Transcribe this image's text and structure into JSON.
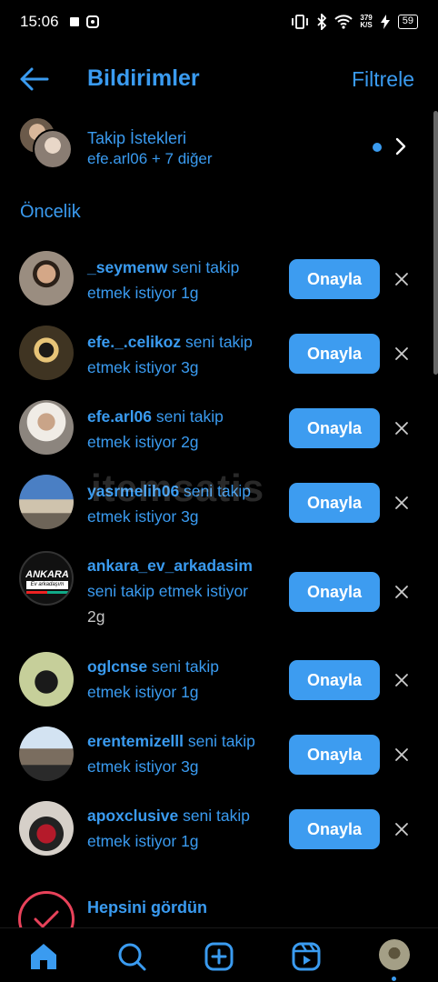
{
  "status_bar": {
    "time": "15:06",
    "net_speed_top": "379",
    "net_speed_bottom": "K/S",
    "battery": "59"
  },
  "header": {
    "title": "Bildirimler",
    "filter_label": "Filtrele"
  },
  "follow_requests": {
    "title": "Takip İstekleri",
    "subtitle": "efe.arl06 + 7 diğer"
  },
  "section_title": "Öncelik",
  "approve_label": "Onayla",
  "requests": [
    {
      "username": "_seymenw",
      "line1_rest": " seni takip",
      "line2": "etmek istiyor 1g",
      "line3": ""
    },
    {
      "username": "efe._.celikoz",
      "line1_rest": " seni takip",
      "line2": "etmek istiyor 3g",
      "line3": ""
    },
    {
      "username": "efe.arl06",
      "line1_rest": " seni takip",
      "line2": "etmek istiyor 2g",
      "line3": ""
    },
    {
      "username": "yasrmelih06",
      "line1_rest": " seni takip",
      "line2": "etmek istiyor 3g",
      "line3": ""
    },
    {
      "username": "ankara_ev_arkadasim",
      "line1_rest": "",
      "line2": "seni takip etmek istiyor",
      "line3": "2g"
    },
    {
      "username": "oglcnse",
      "line1_rest": " seni takip",
      "line2": "etmek istiyor 1g",
      "line3": ""
    },
    {
      "username": "erentemizelll",
      "line1_rest": " seni takip",
      "line2": "etmek istiyor 3g",
      "line3": ""
    },
    {
      "username": "apoxclusive",
      "line1_rest": " seni takip",
      "line2": "etmek istiyor 1g",
      "line3": ""
    }
  ],
  "ankara_avatar": {
    "title": "ANKARA",
    "sub": "Ev arkadaşım"
  },
  "seen": {
    "title": "Hepsini gördün"
  },
  "watermark": "itemsatis",
  "colors": {
    "accent": "#3a9bf0",
    "button": "#3d9cf0",
    "background": "#000000",
    "seen_ring": "#e8425a"
  }
}
